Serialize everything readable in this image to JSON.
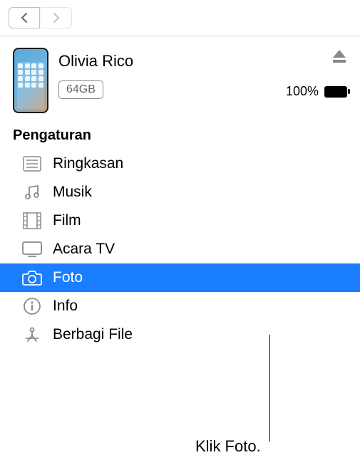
{
  "device": {
    "name": "Olivia Rico",
    "storage": "64GB",
    "battery_percent": "100%"
  },
  "section": {
    "title": "Pengaturan"
  },
  "sidebar": {
    "items": [
      {
        "label": "Ringkasan"
      },
      {
        "label": "Musik"
      },
      {
        "label": "Film"
      },
      {
        "label": "Acara TV"
      },
      {
        "label": "Foto"
      },
      {
        "label": "Info"
      },
      {
        "label": "Berbagi File"
      }
    ]
  },
  "callout": {
    "text": "Klik Foto."
  }
}
